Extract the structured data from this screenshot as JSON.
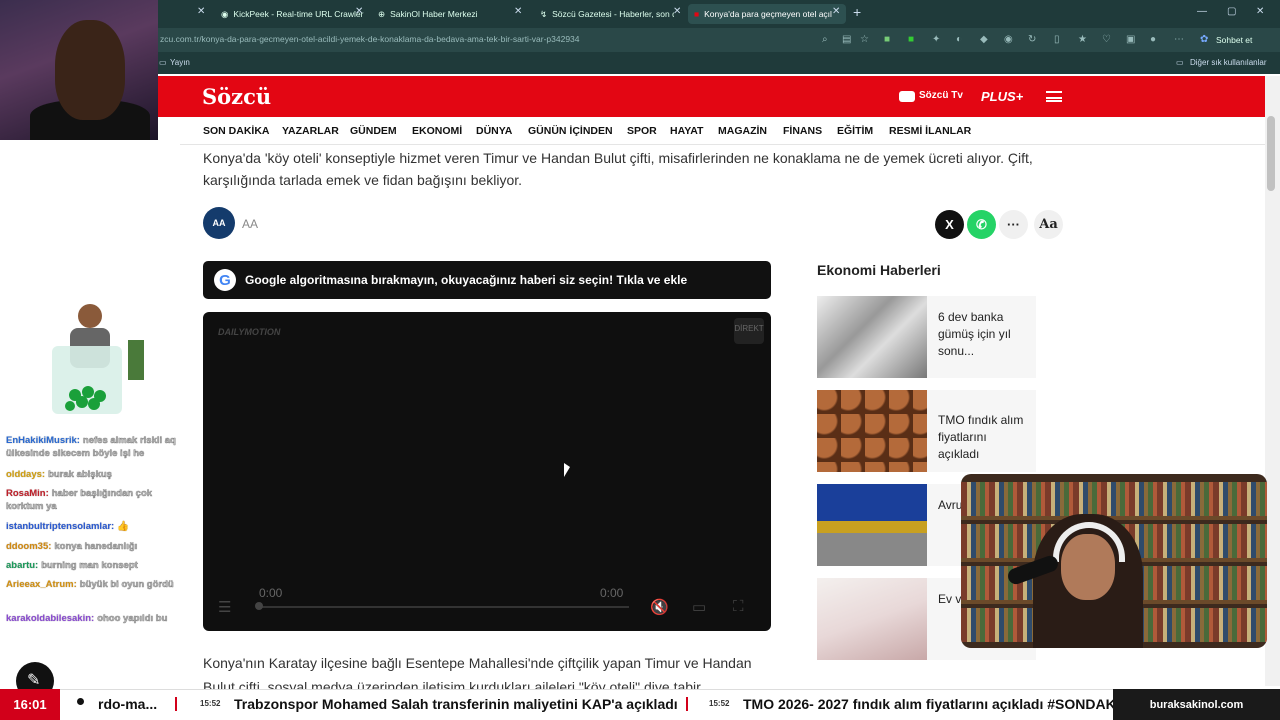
{
  "browser": {
    "tabs": [
      {
        "label": "KickPeek - Real-time URL Crawler",
        "active": false
      },
      {
        "label": "SakinOl Haber Merkezi",
        "active": false
      },
      {
        "label": "Sözcü Gazetesi - Haberler, son da",
        "active": false
      },
      {
        "label": "Konya'da para geçmeyen otel açıl",
        "active": true
      }
    ],
    "url": "zcu.com.tr/konya-da-para-gecmeyen-otel-acildi-yemek-de-konaklama-da-bedava-ama-tek-bir-sarti-var-p342934",
    "bookmark": "Yayın",
    "other_bookmarks": "Diğer sık kullanılanlar",
    "copilot": "Sohbet et"
  },
  "site": {
    "logo": "Sözcü",
    "tv_label": "Sözcü Tv",
    "plus_label": "PLUS+",
    "nav": [
      "SON DAKİKA",
      "YAZARLAR",
      "GÜNDEM",
      "EKONOMİ",
      "DÜNYA",
      "GÜNÜN İÇİNDEN",
      "SPOR",
      "HAYAT",
      "MAGAZİN",
      "FİNANS",
      "EĞİTİM",
      "RESMİ İLANLAR"
    ]
  },
  "article": {
    "summary": "Konya'da 'köy oteli' konseptiyle hizmet veren Timur ve Handan Bulut çifti, misafirlerinden ne konaklama ne de yemek ücreti alıyor. Çift, karşılığında tarlada emek ve fidan bağışını bekliyor.",
    "source_logo": "AA",
    "source": "AA",
    "share_x": "X",
    "share_more": "···",
    "font_size": "Aa",
    "google_cta": "Google algoritmasına bırakmayın, okuyacağınız haberi siz seçin! Tıkla ve ekle",
    "video": {
      "brand": "DAILYMOTION",
      "current_time": "0:00",
      "duration": "0:00",
      "corner_label": "DİREKT"
    },
    "body": "Konya'nın Karatay ilçesine bağlı Esentepe Mahallesi'nde çiftçilik yapan Timur ve Handan Bulut çifti, sosyal medya üzerinden iletişim kurdukları aileleri \"köy oteli\" diye tabir"
  },
  "sidebar": {
    "title": "Ekonomi Haberleri",
    "cards": [
      {
        "text": "6 dev banka gümüş için yıl sonu..."
      },
      {
        "text": "TMO fındık alım fiyatlarını açıkladı"
      },
      {
        "text": "Avru bekl oran"
      },
      {
        "text": "Ev ve sata Bu kr"
      }
    ]
  },
  "chat": [
    {
      "user": "EnHakikiMusrik:",
      "msg": "nefes almak riskli aq ülkesinde sikecem böyle işi he",
      "color": "#2a6ad2"
    },
    {
      "user": "olddays:",
      "msg": "burak abişkuş",
      "color": "#d2a010"
    },
    {
      "user": "RosaMin:",
      "msg": "haber başlığından çok korktum ya",
      "color": "#c0202a"
    },
    {
      "user": "istanbultriptensolamlar:",
      "msg": "👍",
      "color": "#2a5ad2"
    },
    {
      "user": "ddoom35:",
      "msg": "konya hanedanlığı",
      "color": "#d28a10"
    },
    {
      "user": "abartu:",
      "msg": "burning man konsept",
      "color": "#1a9a5a"
    },
    {
      "user": "Arieeax_Atrum:",
      "msg": "büyük bi oyun gördü",
      "color": "#d29010"
    },
    {
      "user": "karakoldabilesakin:",
      "msg": "ohoo yapıldı bu",
      "color": "#8a4ad2"
    }
  ],
  "ticker": {
    "clock": "16:01",
    "items": [
      {
        "time": "",
        "text": "rdo-ma..."
      },
      {
        "time": "15:52",
        "text": "Trabzonspor Mohamed Salah transferinin maliyetini KAP'a açıkladı"
      },
      {
        "time": "15:52",
        "text": "TMO 2026- 2027 fındık alım fiyatlarını açıkladı #SONDAK"
      }
    ],
    "site": "buraksakinol.com"
  },
  "colors": {
    "brand_red": "#e30613",
    "ticker_red": "#d2001a",
    "whatsapp": "#25d366"
  }
}
